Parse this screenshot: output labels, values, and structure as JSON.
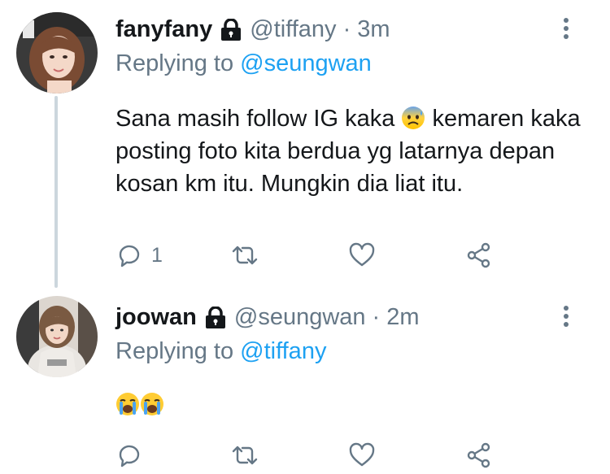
{
  "colors": {
    "link_blue": "#1da1f2",
    "secondary_gray": "#657786",
    "text": "#14171a",
    "thread_line": "#ccd6dd"
  },
  "tweets": [
    {
      "display_name": "fanyfany",
      "lock_icon": "lock-icon",
      "handle": "@tiffany",
      "separator": "·",
      "time": "3m",
      "reply_prefix": "Replying to",
      "reply_to": "@seungwan",
      "text_before_emoji": "Sana masih follow IG kaka ",
      "emoji": "anxious-face-with-sweat",
      "text_after_emoji": " kemaren kaka posting foto kita berdua yg latarnya depan kosan km itu. Mungkin dia liat itu.",
      "reply_count": "1",
      "icons": [
        "reply-icon",
        "retweet-icon",
        "like-icon",
        "share-icon",
        "more-icon"
      ]
    },
    {
      "display_name": "joowan",
      "lock_icon": "lock-icon",
      "handle": "@seungwan",
      "separator": "·",
      "time": "2m",
      "reply_prefix": "Replying to",
      "reply_to": "@tiffany",
      "emojis": [
        "loudly-crying-face",
        "loudly-crying-face"
      ],
      "icons": [
        "reply-icon",
        "retweet-icon",
        "like-icon",
        "share-icon",
        "more-icon"
      ]
    }
  ]
}
